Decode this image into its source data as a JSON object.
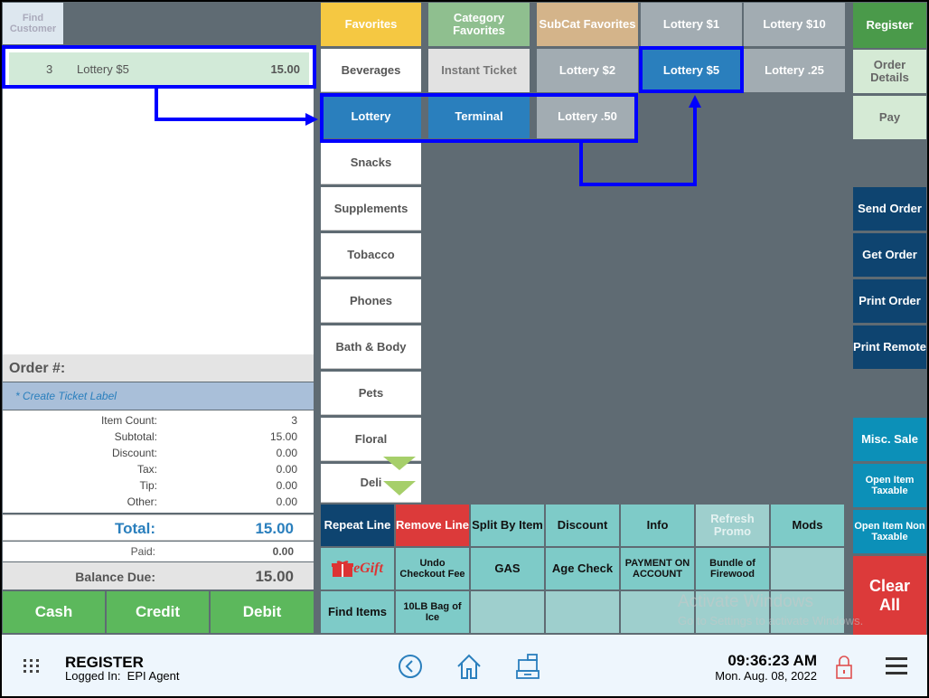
{
  "left": {
    "find_customer": "Find Customer",
    "order_lines": [
      {
        "qty": "3",
        "name": "Lottery $5",
        "amount": "15.00"
      }
    ],
    "order_number_label": "Order #:",
    "ticket_label": "* Create Ticket Label",
    "summary": [
      {
        "label": "Item Count:",
        "value": "3"
      },
      {
        "label": "Subtotal:",
        "value": "15.00"
      },
      {
        "label": "Discount:",
        "value": "0.00"
      },
      {
        "label": "Tax:",
        "value": "0.00"
      },
      {
        "label": "Tip:",
        "value": "0.00"
      },
      {
        "label": "Other:",
        "value": "0.00"
      }
    ],
    "total_label": "Total:",
    "total_value": "15.00",
    "paid_label": "Paid:",
    "paid_value": "0.00",
    "balance_label": "Balance Due:",
    "balance_value": "15.00",
    "pay_buttons": [
      "Cash",
      "Credit",
      "Debit"
    ]
  },
  "categories": [
    "Favorites",
    "Beverages",
    "Lottery",
    "Snacks",
    "Supplements",
    "Tobacco",
    "Phones",
    "Bath & Body",
    "Pets",
    "Floral",
    "Deli"
  ],
  "subcategories": {
    "row1": [
      "Category Favorites",
      "SubCat Favorites",
      "Lottery $1",
      "Lottery $10"
    ],
    "row2": [
      "Instant Ticket",
      "Lottery $2",
      "Lottery $5",
      "Lottery .25"
    ],
    "row3": [
      "Terminal",
      "Lottery .50"
    ]
  },
  "right": {
    "top": [
      "Register",
      "Order Details",
      "Pay"
    ],
    "orders": [
      "Send Order",
      "Get Order",
      "Print Order",
      "Print Remote"
    ],
    "misc": [
      "Misc. Sale",
      "Open Item Taxable",
      "Open Item Non Taxable"
    ],
    "clear_all": "Clear All"
  },
  "actions": {
    "row1": [
      "Repeat Line",
      "Remove Line",
      "Split By Item",
      "Discount",
      "Info",
      "Refresh Promo",
      "Mods"
    ],
    "row2": [
      "eGift",
      "Undo Checkout Fee",
      "GAS",
      "Age Check",
      "PAYMENT ON ACCOUNT",
      "Bundle of Firewood",
      ""
    ],
    "row3": [
      "Find Items",
      "10LB Bag of Ice",
      "",
      "",
      "",
      "",
      ""
    ]
  },
  "watermark": {
    "title": "Activate Windows",
    "subtitle": "Go to Settings to activate Windows."
  },
  "footer": {
    "title": "REGISTER",
    "logged_in": "Logged In:  EPI Agent",
    "time": "09:36:23 AM",
    "date": "Mon. Aug. 08, 2022"
  },
  "colors": {
    "annotation": "#0000ff",
    "selected": "#2a7fbd",
    "clear": "#dc3a3a",
    "register": "#4a9a4a"
  }
}
